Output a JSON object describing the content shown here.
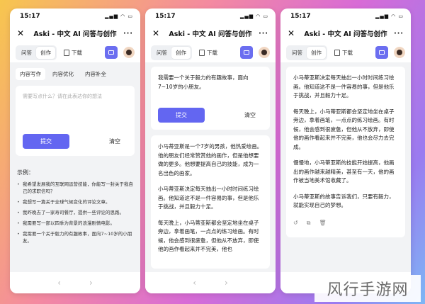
{
  "status": {
    "time": "15:17",
    "icons": "▂▄▆ ◠ ▭"
  },
  "app": {
    "title": "Aski - 中文 AI 问答与创作",
    "close": "✕",
    "more": "···"
  },
  "toolbar": {
    "tab_qa": "问答",
    "tab_create": "创作",
    "download": "下载"
  },
  "screen1": {
    "subtabs": [
      "内容写作",
      "内容优化",
      "内容补全"
    ],
    "placeholder": "需要写点什么？请在此表达你的想法",
    "submit": "提交",
    "clear": "清空",
    "examples_title": "示例：",
    "examples": [
      "我希望发展我的互联网运营技能，你能写一封关于我自己的求职信吗？",
      "我想写一篇关于全球气候变化的评论文章。",
      "我昨晚去了一家寿司餐厅，提供一些评论的思路。",
      "我需要写一部以四季为背景的浪漫剧情电影。",
      "我需要一个关于毅力的有趣故事，面向7~10岁的小朋友。"
    ]
  },
  "screen2": {
    "question": "我需要一个关于毅力的有趣故事，面向7~10岁的小朋友。",
    "submit": "提交",
    "clear": "清空",
    "paragraphs": [
      "小马蒂亚斯是一个7岁的男孩，他热爱绘画。他的朋友们经常赞赏他的画作，但是他想要做的更多。他想要提高自己的技能，成为一名出色的画家。",
      "小马蒂亚斯决定每天抽出一小时时间练习绘画。他知道这不是一件容易的事，但是他乐于挑战，并且毅力十足。",
      "每天晚上，小马蒂亚斯都会坚定地坐在桌子旁边，拿着画笔，一点点的练习绘画。有时候，他会感到很疲惫，但他从不放弃，即使他的画作看起来并不完美，他也"
    ]
  },
  "screen3": {
    "paragraphs": [
      "小马蒂亚斯决定每天抽出一小时时间练习绘画。他知道这不是一件容易的事，但是他乐于挑战，并且毅力十足。",
      "每天晚上，小马蒂亚斯都会坚定地坐在桌子旁边，拿着画笔，一点点的练习绘画。有时候，他会感到很疲惫，但他从不放弃，即使他的画作看起来并不完美，他也会尽力去完成。",
      "慢慢地，小马蒂亚斯的技能开始提高，他画出的画作越来越精美，甚至有一天，他的画作被当地美术馆收藏了。",
      "小马蒂亚斯的故事告诉我们，只要有毅力，就能实现自己的梦想。"
    ],
    "actions": [
      "↺",
      "⧉",
      "🗑"
    ]
  },
  "nav": {
    "back": "‹",
    "forward": "›"
  },
  "watermark": "风行手游网",
  "colors": {
    "accent": "#6366f1"
  }
}
